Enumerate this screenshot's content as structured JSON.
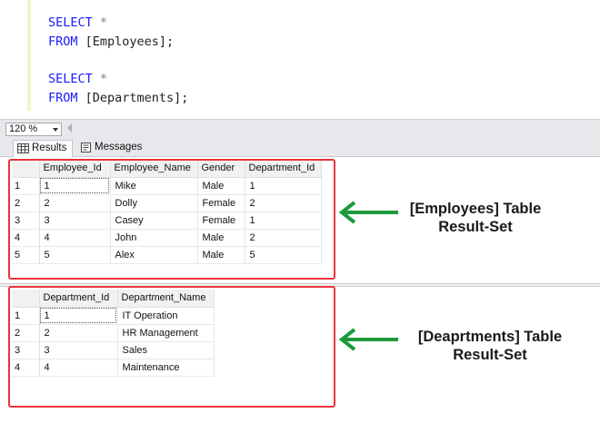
{
  "editor": {
    "lines": [
      {
        "kw": "SELECT",
        "rest": " *"
      },
      {
        "kw": "FROM",
        "rest": " [Employees];"
      },
      {
        "kw": "SELECT",
        "rest": " *"
      },
      {
        "kw": "FROM",
        "rest": " [Departments];"
      }
    ]
  },
  "zoom": {
    "value": "120 %"
  },
  "tabs": [
    {
      "label": "Results",
      "icon": "grid-icon"
    },
    {
      "label": "Messages",
      "icon": "messages-icon"
    }
  ],
  "employees": {
    "columns": [
      "Employee_Id",
      "Employee_Name",
      "Gender",
      "Department_Id"
    ],
    "rows": [
      {
        "rn": "1",
        "cells": [
          "1",
          "Mike",
          "Male",
          "1"
        ]
      },
      {
        "rn": "2",
        "cells": [
          "2",
          "Dolly",
          "Female",
          "2"
        ]
      },
      {
        "rn": "3",
        "cells": [
          "3",
          "Casey",
          "Female",
          "1"
        ]
      },
      {
        "rn": "4",
        "cells": [
          "4",
          "John",
          "Male",
          "2"
        ]
      },
      {
        "rn": "5",
        "cells": [
          "5",
          "Alex",
          "Male",
          "5"
        ]
      }
    ]
  },
  "departments": {
    "columns": [
      "Department_Id",
      "Department_Name"
    ],
    "rows": [
      {
        "rn": "1",
        "cells": [
          "1",
          "IT Operation"
        ]
      },
      {
        "rn": "2",
        "cells": [
          "2",
          "HR Management"
        ]
      },
      {
        "rn": "3",
        "cells": [
          "3",
          "Sales"
        ]
      },
      {
        "rn": "4",
        "cells": [
          "4",
          "Maintenance"
        ]
      }
    ]
  },
  "annotations": {
    "employees_line1": "[Employees] Table",
    "employees_line2": "Result-Set",
    "departments_line1": "[Deaprtments] Table",
    "departments_line2": "Result-Set",
    "box_color": "#e8343a",
    "arrow_color": "#1f9a3a"
  }
}
